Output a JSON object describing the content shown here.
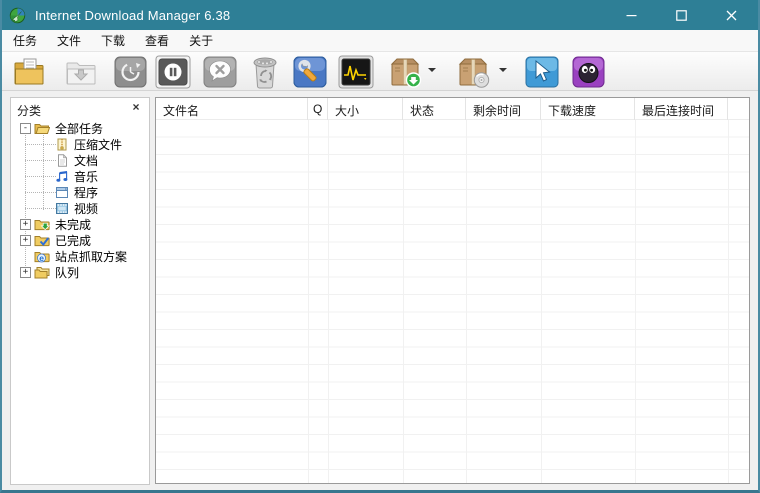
{
  "window": {
    "title": "Internet Download Manager 6.38",
    "titlebar_color": "#2e7f96",
    "controls": [
      "minimize",
      "maximize",
      "close"
    ]
  },
  "menu": {
    "items": [
      "任务",
      "文件",
      "下载",
      "查看",
      "关于"
    ]
  },
  "toolbar": {
    "buttons": [
      {
        "icon": "add-url-icon"
      },
      {
        "icon": "resume-icon",
        "disabled": true
      },
      {
        "icon": "restart-icon",
        "disabled": true
      },
      {
        "icon": "stop-icon"
      },
      {
        "icon": "stop-all-icon"
      },
      {
        "icon": "delete-all-completed-icon"
      },
      {
        "icon": "options-icon"
      },
      {
        "icon": "scheduler-icon"
      },
      {
        "icon": "start-queue-icon",
        "has_dropdown": true
      },
      {
        "icon": "stop-queue-icon",
        "has_dropdown": true
      },
      {
        "icon": "grabber-icon"
      },
      {
        "icon": "tell-a-friend-icon"
      }
    ]
  },
  "sidebar": {
    "header": "分类",
    "close_glyph": "×",
    "tree": [
      {
        "label": "全部任务",
        "level": 0,
        "expander": "-",
        "icon": "folder-open-icon"
      },
      {
        "label": "压缩文件",
        "level": 1,
        "icon": "zip-file-icon"
      },
      {
        "label": "文档",
        "level": 1,
        "icon": "document-icon"
      },
      {
        "label": "音乐",
        "level": 1,
        "icon": "music-icon"
      },
      {
        "label": "程序",
        "level": 1,
        "icon": "program-icon"
      },
      {
        "label": "视频",
        "level": 1,
        "icon": "video-icon"
      },
      {
        "label": "未完成",
        "level": 0,
        "expander": "+",
        "icon": "folder-unfinished-icon"
      },
      {
        "label": "已完成",
        "level": 0,
        "expander": "+",
        "icon": "folder-finished-icon"
      },
      {
        "label": "站点抓取方案",
        "level": 0,
        "expander": null,
        "icon": "grabber-projects-icon"
      },
      {
        "label": "队列",
        "level": 0,
        "expander": "+",
        "icon": "queues-icon"
      }
    ]
  },
  "table": {
    "columns": [
      {
        "label": "文件名"
      },
      {
        "label": "Q"
      },
      {
        "label": "大小"
      },
      {
        "label": "状态"
      },
      {
        "label": "剩余时间"
      },
      {
        "label": "下载速度"
      },
      {
        "label": "最后连接时间"
      }
    ],
    "rows": []
  }
}
